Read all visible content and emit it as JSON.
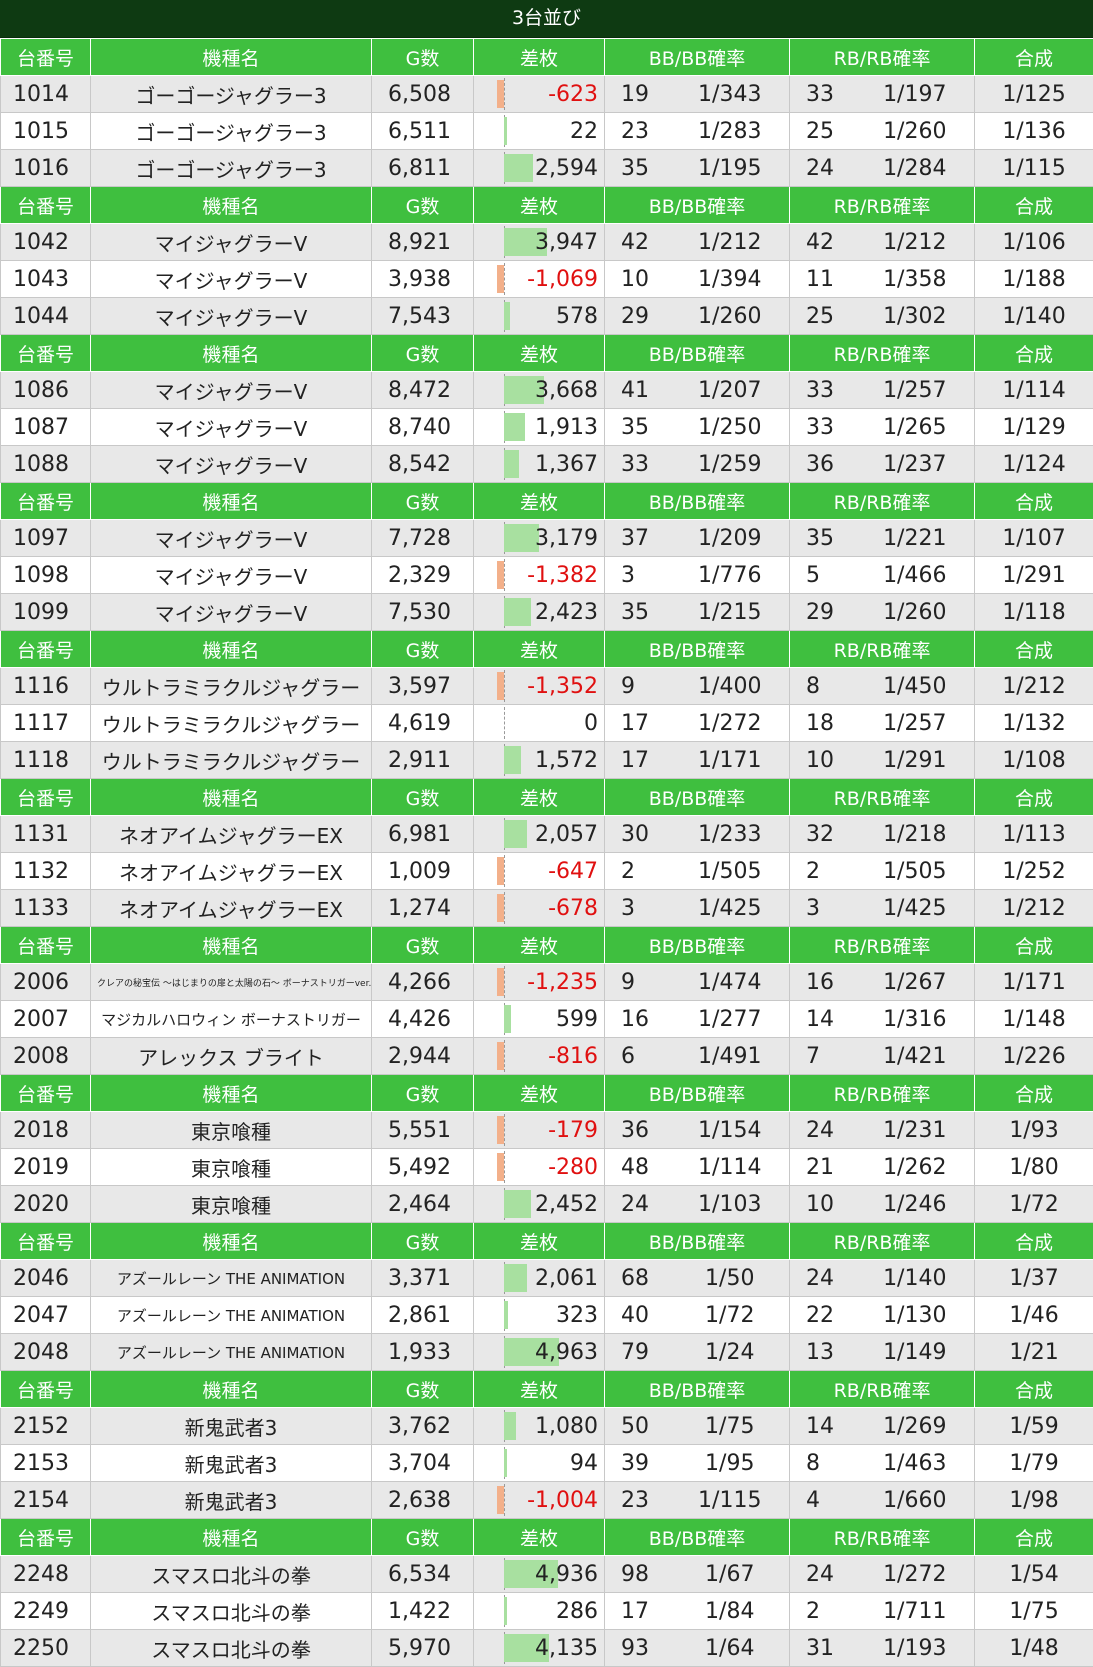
{
  "title": "3台並び",
  "header": {
    "no": "台番号",
    "name": "機種名",
    "games": "G数",
    "diff": "差枚",
    "bb": "BB/BB確率",
    "rb": "RB/RB確率",
    "total": "合成"
  },
  "groups": [
    {
      "rows": [
        {
          "no": "1014",
          "name": "ゴーゴージャグラー3",
          "games": "6,508",
          "diff": "-623",
          "diff_value": -623,
          "bb": "19",
          "bb_rate": "1/343",
          "rb": "33",
          "rb_rate": "1/197",
          "total": "1/125"
        },
        {
          "no": "1015",
          "name": "ゴーゴージャグラー3",
          "games": "6,511",
          "diff": "22",
          "diff_value": 22,
          "bb": "23",
          "bb_rate": "1/283",
          "rb": "25",
          "rb_rate": "1/260",
          "total": "1/136"
        },
        {
          "no": "1016",
          "name": "ゴーゴージャグラー3",
          "games": "6,811",
          "diff": "2,594",
          "diff_value": 2594,
          "bb": "35",
          "bb_rate": "1/195",
          "rb": "24",
          "rb_rate": "1/284",
          "total": "1/115"
        }
      ]
    },
    {
      "rows": [
        {
          "no": "1042",
          "name": "マイジャグラーV",
          "games": "8,921",
          "diff": "3,947",
          "diff_value": 3947,
          "bb": "42",
          "bb_rate": "1/212",
          "rb": "42",
          "rb_rate": "1/212",
          "total": "1/106"
        },
        {
          "no": "1043",
          "name": "マイジャグラーV",
          "games": "3,938",
          "diff": "-1,069",
          "diff_value": -1069,
          "bb": "10",
          "bb_rate": "1/394",
          "rb": "11",
          "rb_rate": "1/358",
          "total": "1/188"
        },
        {
          "no": "1044",
          "name": "マイジャグラーV",
          "games": "7,543",
          "diff": "578",
          "diff_value": 578,
          "bb": "29",
          "bb_rate": "1/260",
          "rb": "25",
          "rb_rate": "1/302",
          "total": "1/140"
        }
      ]
    },
    {
      "rows": [
        {
          "no": "1086",
          "name": "マイジャグラーV",
          "games": "8,472",
          "diff": "3,668",
          "diff_value": 3668,
          "bb": "41",
          "bb_rate": "1/207",
          "rb": "33",
          "rb_rate": "1/257",
          "total": "1/114"
        },
        {
          "no": "1087",
          "name": "マイジャグラーV",
          "games": "8,740",
          "diff": "1,913",
          "diff_value": 1913,
          "bb": "35",
          "bb_rate": "1/250",
          "rb": "33",
          "rb_rate": "1/265",
          "total": "1/129"
        },
        {
          "no": "1088",
          "name": "マイジャグラーV",
          "games": "8,542",
          "diff": "1,367",
          "diff_value": 1367,
          "bb": "33",
          "bb_rate": "1/259",
          "rb": "36",
          "rb_rate": "1/237",
          "total": "1/124"
        }
      ]
    },
    {
      "rows": [
        {
          "no": "1097",
          "name": "マイジャグラーV",
          "games": "7,728",
          "diff": "3,179",
          "diff_value": 3179,
          "bb": "37",
          "bb_rate": "1/209",
          "rb": "35",
          "rb_rate": "1/221",
          "total": "1/107"
        },
        {
          "no": "1098",
          "name": "マイジャグラーV",
          "games": "2,329",
          "diff": "-1,382",
          "diff_value": -1382,
          "bb": "3",
          "bb_rate": "1/776",
          "rb": "5",
          "rb_rate": "1/466",
          "total": "1/291"
        },
        {
          "no": "1099",
          "name": "マイジャグラーV",
          "games": "7,530",
          "diff": "2,423",
          "diff_value": 2423,
          "bb": "35",
          "bb_rate": "1/215",
          "rb": "29",
          "rb_rate": "1/260",
          "total": "1/118"
        }
      ]
    },
    {
      "rows": [
        {
          "no": "1116",
          "name": "ウルトラミラクルジャグラー",
          "games": "3,597",
          "diff": "-1,352",
          "diff_value": -1352,
          "bb": "9",
          "bb_rate": "1/400",
          "rb": "8",
          "rb_rate": "1/450",
          "total": "1/212"
        },
        {
          "no": "1117",
          "name": "ウルトラミラクルジャグラー",
          "games": "4,619",
          "diff": "0",
          "diff_value": 0,
          "bb": "17",
          "bb_rate": "1/272",
          "rb": "18",
          "rb_rate": "1/257",
          "total": "1/132"
        },
        {
          "no": "1118",
          "name": "ウルトラミラクルジャグラー",
          "games": "2,911",
          "diff": "1,572",
          "diff_value": 1572,
          "bb": "17",
          "bb_rate": "1/171",
          "rb": "10",
          "rb_rate": "1/291",
          "total": "1/108"
        }
      ]
    },
    {
      "rows": [
        {
          "no": "1131",
          "name": "ネオアイムジャグラーEX",
          "games": "6,981",
          "diff": "2,057",
          "diff_value": 2057,
          "bb": "30",
          "bb_rate": "1/233",
          "rb": "32",
          "rb_rate": "1/218",
          "total": "1/113"
        },
        {
          "no": "1132",
          "name": "ネオアイムジャグラーEX",
          "games": "1,009",
          "diff": "-647",
          "diff_value": -647,
          "bb": "2",
          "bb_rate": "1/505",
          "rb": "2",
          "rb_rate": "1/505",
          "total": "1/252"
        },
        {
          "no": "1133",
          "name": "ネオアイムジャグラーEX",
          "games": "1,274",
          "diff": "-678",
          "diff_value": -678,
          "bb": "3",
          "bb_rate": "1/425",
          "rb": "3",
          "rb_rate": "1/425",
          "total": "1/212"
        }
      ]
    },
    {
      "rows": [
        {
          "no": "2006",
          "name": "クレアの秘宝伝 ～はじまりの扉と太陽の石～ ボーナストリガーver.",
          "size": "tiny",
          "games": "4,266",
          "diff": "-1,235",
          "diff_value": -1235,
          "bb": "9",
          "bb_rate": "1/474",
          "rb": "16",
          "rb_rate": "1/267",
          "total": "1/171"
        },
        {
          "no": "2007",
          "name": "マジカルハロウィン ボーナストリガー",
          "size": "small",
          "games": "4,426",
          "diff": "599",
          "diff_value": 599,
          "bb": "16",
          "bb_rate": "1/277",
          "rb": "14",
          "rb_rate": "1/316",
          "total": "1/148"
        },
        {
          "no": "2008",
          "name": "アレックス ブライト",
          "games": "2,944",
          "diff": "-816",
          "diff_value": -816,
          "bb": "6",
          "bb_rate": "1/491",
          "rb": "7",
          "rb_rate": "1/421",
          "total": "1/226"
        }
      ]
    },
    {
      "rows": [
        {
          "no": "2018",
          "name": "東京喰種",
          "games": "5,551",
          "diff": "-179",
          "diff_value": -179,
          "bb": "36",
          "bb_rate": "1/154",
          "rb": "24",
          "rb_rate": "1/231",
          "total": "1/93"
        },
        {
          "no": "2019",
          "name": "東京喰種",
          "games": "5,492",
          "diff": "-280",
          "diff_value": -280,
          "bb": "48",
          "bb_rate": "1/114",
          "rb": "21",
          "rb_rate": "1/262",
          "total": "1/80"
        },
        {
          "no": "2020",
          "name": "東京喰種",
          "games": "2,464",
          "diff": "2,452",
          "diff_value": 2452,
          "bb": "24",
          "bb_rate": "1/103",
          "rb": "10",
          "rb_rate": "1/246",
          "total": "1/72"
        }
      ]
    },
    {
      "rows": [
        {
          "no": "2046",
          "name": "アズールレーン THE ANIMATION",
          "size": "small",
          "games": "3,371",
          "diff": "2,061",
          "diff_value": 2061,
          "bb": "68",
          "bb_rate": "1/50",
          "rb": "24",
          "rb_rate": "1/140",
          "total": "1/37"
        },
        {
          "no": "2047",
          "name": "アズールレーン THE ANIMATION",
          "size": "small",
          "games": "2,861",
          "diff": "323",
          "diff_value": 323,
          "bb": "40",
          "bb_rate": "1/72",
          "rb": "22",
          "rb_rate": "1/130",
          "total": "1/46"
        },
        {
          "no": "2048",
          "name": "アズールレーン THE ANIMATION",
          "size": "small",
          "games": "1,933",
          "diff": "4,963",
          "diff_value": 4963,
          "bb": "79",
          "bb_rate": "1/24",
          "rb": "13",
          "rb_rate": "1/149",
          "total": "1/21"
        }
      ]
    },
    {
      "rows": [
        {
          "no": "2152",
          "name": "新鬼武者3",
          "games": "3,762",
          "diff": "1,080",
          "diff_value": 1080,
          "bb": "50",
          "bb_rate": "1/75",
          "rb": "14",
          "rb_rate": "1/269",
          "total": "1/59"
        },
        {
          "no": "2153",
          "name": "新鬼武者3",
          "games": "3,704",
          "diff": "94",
          "diff_value": 94,
          "bb": "39",
          "bb_rate": "1/95",
          "rb": "8",
          "rb_rate": "1/463",
          "total": "1/79"
        },
        {
          "no": "2154",
          "name": "新鬼武者3",
          "games": "2,638",
          "diff": "-1,004",
          "diff_value": -1004,
          "bb": "23",
          "bb_rate": "1/115",
          "rb": "4",
          "rb_rate": "1/660",
          "total": "1/98"
        }
      ]
    },
    {
      "rows": [
        {
          "no": "2248",
          "name": "スマスロ北斗の拳",
          "games": "6,534",
          "diff": "4,936",
          "diff_value": 4936,
          "bb": "98",
          "bb_rate": "1/67",
          "rb": "24",
          "rb_rate": "1/272",
          "total": "1/54"
        },
        {
          "no": "2249",
          "name": "スマスロ北斗の拳",
          "games": "1,422",
          "diff": "286",
          "diff_value": 286,
          "bb": "17",
          "bb_rate": "1/84",
          "rb": "2",
          "rb_rate": "1/711",
          "total": "1/75"
        },
        {
          "no": "2250",
          "name": "スマスロ北斗の拳",
          "games": "5,970",
          "diff": "4,135",
          "diff_value": 4135,
          "bb": "93",
          "bb_rate": "1/64",
          "rb": "31",
          "rb_rate": "1/193",
          "total": "1/48"
        }
      ]
    }
  ]
}
